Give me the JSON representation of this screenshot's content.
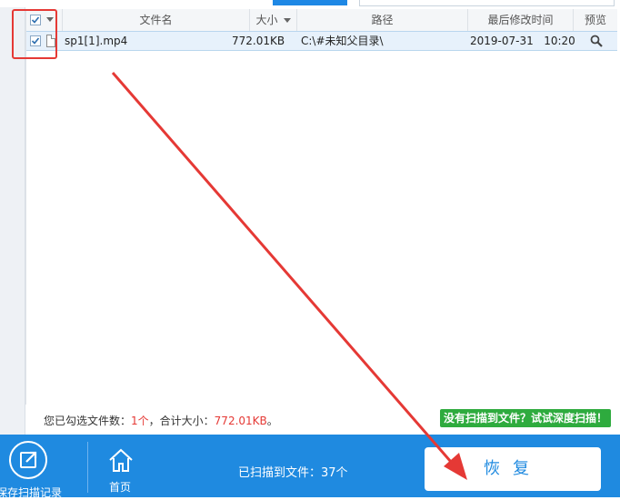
{
  "table": {
    "headers": {
      "name": "文件名",
      "size": "大小",
      "path": "路径",
      "time": "最后修改时间",
      "preview": "预览"
    },
    "rows": [
      {
        "name": "sp1[1].mp4",
        "size": "772.01KB",
        "path": "C:\\#未知父目录\\",
        "date": "2019-07-31",
        "time": "10:20"
      }
    ]
  },
  "status": {
    "prefix": "您已勾选文件数：",
    "count": "1个",
    "middle": "，合计大小：",
    "total": "772.01KB",
    "suffix": "。"
  },
  "deep_scan_label": "没有扫描到文件？试试深度扫描！",
  "bottom": {
    "save_record_label": "保存扫描记录",
    "home_label": "首页",
    "scanned_label": "已扫描到文件：37个",
    "recover_label": "恢复"
  },
  "colors": {
    "accent": "#1f8ae0",
    "highlight": "#e53935",
    "deep_scan": "#2eab3e"
  }
}
